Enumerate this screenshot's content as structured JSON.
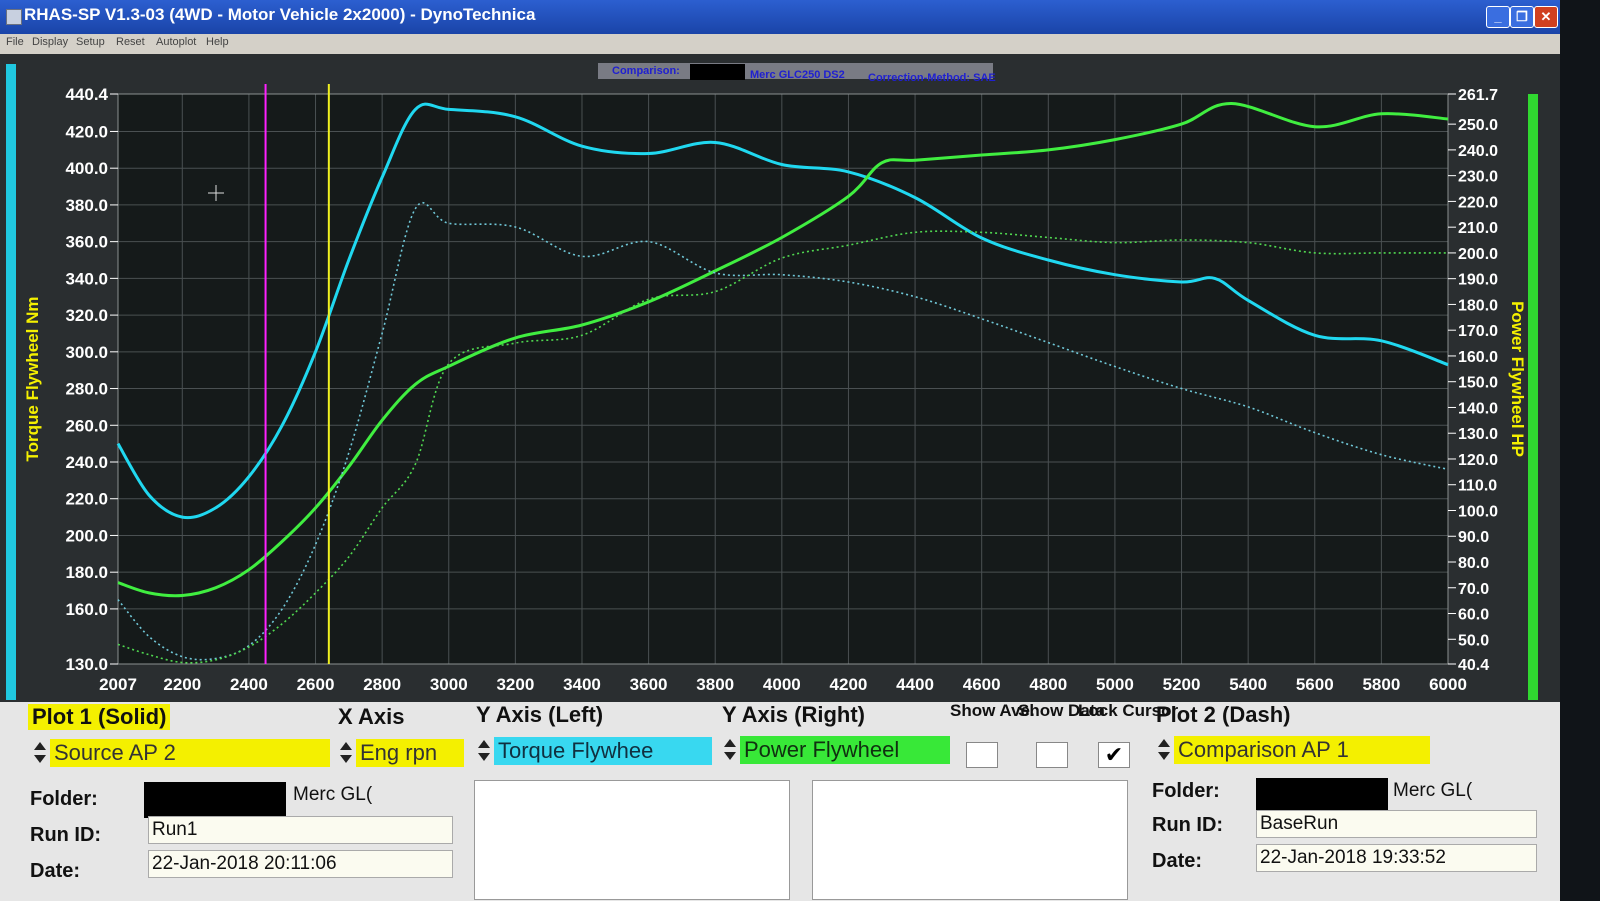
{
  "window": {
    "title": "RHAS-SP V1.3-03  (4WD - Motor Vehicle 2x2000) - DynoTechnica",
    "menu": [
      "File",
      "Display",
      "Setup",
      "Reset",
      "Autoplot",
      "Help"
    ]
  },
  "chart_header": {
    "comparison_label": "Comparison:",
    "comparison_value": "Merc GLC250 DS2",
    "correction": "Correction-Method: SAE"
  },
  "chart_data": {
    "type": "line",
    "xlabel": "",
    "ylabel_left": "Torque Flywheel Nm",
    "ylabel_right": "Power Flywheel HP",
    "xlim": [
      2007,
      6000
    ],
    "ylim_left": [
      130.0,
      440.4
    ],
    "ylim_right": [
      40.4,
      261.7
    ],
    "x_ticks": [
      "2007",
      "2200",
      "2400",
      "2600",
      "2800",
      "3000",
      "3200",
      "3400",
      "3600",
      "3800",
      "4000",
      "4200",
      "4400",
      "4600",
      "4800",
      "5000",
      "5200",
      "5400",
      "5600",
      "5800",
      "6000"
    ],
    "y_left_ticks": [
      "440.4",
      "420.0",
      "400.0",
      "380.0",
      "360.0",
      "340.0",
      "320.0",
      "300.0",
      "280.0",
      "260.0",
      "240.0",
      "220.0",
      "200.0",
      "180.0",
      "160.0",
      "130.0"
    ],
    "y_right_ticks": [
      "261.7",
      "250.0",
      "240.0",
      "230.0",
      "220.0",
      "210.0",
      "200.0",
      "190.0",
      "180.0",
      "170.0",
      "160.0",
      "150.0",
      "140.0",
      "130.0",
      "120.0",
      "110.0",
      "100.0",
      "90.0",
      "80.0",
      "70.0",
      "60.0",
      "50.0",
      "40.4"
    ],
    "grid": true,
    "series": [
      {
        "name": "Torque Flywheel",
        "axis": "left",
        "color": "#20d8f0",
        "style": "solid",
        "points": [
          [
            2007,
            250
          ],
          [
            2100,
            222
          ],
          [
            2200,
            210
          ],
          [
            2300,
            215
          ],
          [
            2400,
            232
          ],
          [
            2500,
            260
          ],
          [
            2600,
            300
          ],
          [
            2700,
            350
          ],
          [
            2800,
            395
          ],
          [
            2900,
            432
          ],
          [
            3000,
            432
          ],
          [
            3200,
            428
          ],
          [
            3400,
            412
          ],
          [
            3600,
            408
          ],
          [
            3800,
            414
          ],
          [
            4000,
            402
          ],
          [
            4200,
            398
          ],
          [
            4400,
            384
          ],
          [
            4600,
            362
          ],
          [
            4800,
            350
          ],
          [
            5000,
            342
          ],
          [
            5200,
            338
          ],
          [
            5300,
            340
          ],
          [
            5400,
            328
          ],
          [
            5600,
            309
          ],
          [
            5800,
            306
          ],
          [
            6000,
            293
          ]
        ]
      },
      {
        "name": "Power Flywheel",
        "axis": "right",
        "color": "#40ee40",
        "style": "solid",
        "points": [
          [
            2007,
            72
          ],
          [
            2100,
            68
          ],
          [
            2200,
            67
          ],
          [
            2300,
            70
          ],
          [
            2400,
            77
          ],
          [
            2500,
            88
          ],
          [
            2600,
            101
          ],
          [
            2700,
            117
          ],
          [
            2800,
            135
          ],
          [
            2900,
            149
          ],
          [
            3000,
            156
          ],
          [
            3200,
            167
          ],
          [
            3400,
            172
          ],
          [
            3600,
            181
          ],
          [
            3800,
            193
          ],
          [
            4000,
            206
          ],
          [
            4200,
            222
          ],
          [
            4300,
            235
          ],
          [
            4400,
            236
          ],
          [
            4600,
            238
          ],
          [
            4800,
            240
          ],
          [
            5000,
            244
          ],
          [
            5200,
            250
          ],
          [
            5350,
            258
          ],
          [
            5600,
            249
          ],
          [
            5800,
            254
          ],
          [
            6000,
            252
          ]
        ]
      },
      {
        "name": "Torque Flywheel (Comparison)",
        "axis": "left",
        "color": "#70c8d8",
        "style": "dashed",
        "points": [
          [
            2007,
            165
          ],
          [
            2100,
            145
          ],
          [
            2200,
            134
          ],
          [
            2300,
            133
          ],
          [
            2400,
            140
          ],
          [
            2500,
            160
          ],
          [
            2600,
            195
          ],
          [
            2700,
            245
          ],
          [
            2800,
            310
          ],
          [
            2900,
            378
          ],
          [
            3000,
            370
          ],
          [
            3200,
            368
          ],
          [
            3400,
            352
          ],
          [
            3600,
            360
          ],
          [
            3800,
            343
          ],
          [
            4000,
            342
          ],
          [
            4200,
            338
          ],
          [
            4400,
            330
          ],
          [
            4600,
            318
          ],
          [
            4800,
            305
          ],
          [
            5000,
            292
          ],
          [
            5200,
            280
          ],
          [
            5400,
            270
          ],
          [
            5600,
            256
          ],
          [
            5800,
            244
          ],
          [
            6000,
            236
          ]
        ]
      },
      {
        "name": "Power Flywheel (Comparison)",
        "axis": "right",
        "color": "#50d850",
        "style": "dashed",
        "points": [
          [
            2007,
            48
          ],
          [
            2100,
            44
          ],
          [
            2200,
            41
          ],
          [
            2300,
            42
          ],
          [
            2400,
            47
          ],
          [
            2500,
            56
          ],
          [
            2600,
            68
          ],
          [
            2700,
            82
          ],
          [
            2800,
            101
          ],
          [
            2900,
            118
          ],
          [
            3000,
            157
          ],
          [
            3200,
            165
          ],
          [
            3400,
            168
          ],
          [
            3600,
            182
          ],
          [
            3800,
            185
          ],
          [
            4000,
            198
          ],
          [
            4200,
            203
          ],
          [
            4400,
            208
          ],
          [
            4600,
            208
          ],
          [
            4800,
            206
          ],
          [
            5000,
            204
          ],
          [
            5200,
            205
          ],
          [
            5400,
            204
          ],
          [
            5600,
            200
          ],
          [
            5800,
            200
          ],
          [
            6000,
            200
          ]
        ]
      }
    ],
    "markers": [
      {
        "name": "cursor-magenta",
        "x": 2450,
        "color": "#ff20ff"
      },
      {
        "name": "cursor-yellow",
        "x": 2640,
        "color": "#f0f020"
      }
    ]
  },
  "panel": {
    "plot1_title": "Plot 1 (Solid)",
    "x_axis_title": "X Axis",
    "y_left_title": "Y Axis (Left)",
    "y_right_title": "Y Axis (Right)",
    "show_ave": "Show Ave.",
    "show_data": "Show Data",
    "lock_cursor": "Lock Cursor",
    "plot2_title": "Plot 2 (Dash)",
    "plot1_source": "Source AP 2",
    "x_axis_value": "Eng rpn",
    "y_left_value": "Torque Flywhee",
    "y_right_value": "Power Flywheel",
    "plot2_source": "Comparison AP 1",
    "show_ave_checked": false,
    "show_data_checked": false,
    "lock_cursor_checked": true,
    "check_mark": "✔",
    "folder_label": "Folder:",
    "run_id_label": "Run ID:",
    "date_label": "Date:",
    "plot1_folder": "Merc GL(",
    "plot1_run_id": "Run1",
    "plot1_date": "22-Jan-2018  20:11:06",
    "plot2_folder": "Merc GL(",
    "plot2_run_id": "BaseRun",
    "plot2_date": "22-Jan-2018  19:33:52"
  }
}
